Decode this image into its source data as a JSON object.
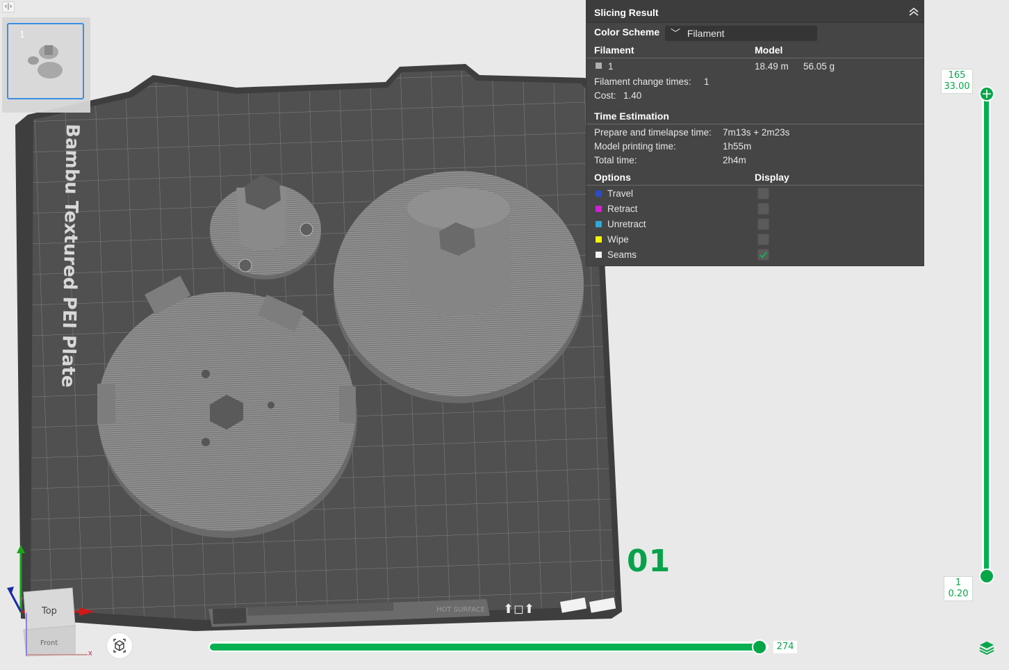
{
  "toolbar": {
    "collapse_icon": "sidebar-toggle-icon"
  },
  "plate": {
    "thumbnail_number": "1",
    "bed_label": "Bambu Textured PEI Plate",
    "plate_number": "01"
  },
  "result_panel": {
    "title": "Slicing Result",
    "color_scheme_label": "Color Scheme",
    "color_scheme_value": "Filament",
    "filament_header": "Filament",
    "model_header": "Model",
    "filament_row": {
      "id": "1",
      "length": "18.49 m",
      "weight": "56.05 g",
      "color": "#b0b0b0"
    },
    "filament_change_label": "Filament change times:",
    "filament_change_value": "1",
    "cost_label": "Cost:",
    "cost_value": "1.40",
    "time_header": "Time Estimation",
    "prepare_label": "Prepare and timelapse time:",
    "prepare_value": "7m13s + 2m23s",
    "model_time_label": "Model printing time:",
    "model_time_value": "1h55m",
    "total_label": "Total time:",
    "total_value": "2h4m",
    "options_header": "Options",
    "display_header": "Display",
    "options": [
      {
        "label": "Travel",
        "color": "#2c4bc7",
        "checked": false
      },
      {
        "label": "Retract",
        "color": "#d61fd6",
        "checked": false
      },
      {
        "label": "Unretract",
        "color": "#2fa8d8",
        "checked": false
      },
      {
        "label": "Wipe",
        "color": "#f5f50a",
        "checked": false
      },
      {
        "label": "Seams",
        "color": "#f2f2f2",
        "checked": true
      }
    ]
  },
  "layer_slider": {
    "top_layer": "165",
    "top_height": "33.00",
    "bottom_layer": "1",
    "bottom_height": "0.20"
  },
  "move_slider": {
    "value": "274"
  },
  "view_cube": {
    "top_label": "Top",
    "front_label": "Front",
    "x_label": "x",
    "y_label": "y"
  },
  "colors": {
    "accent": "#06a648",
    "panel_bg": "#454545",
    "bed": "#505050"
  }
}
